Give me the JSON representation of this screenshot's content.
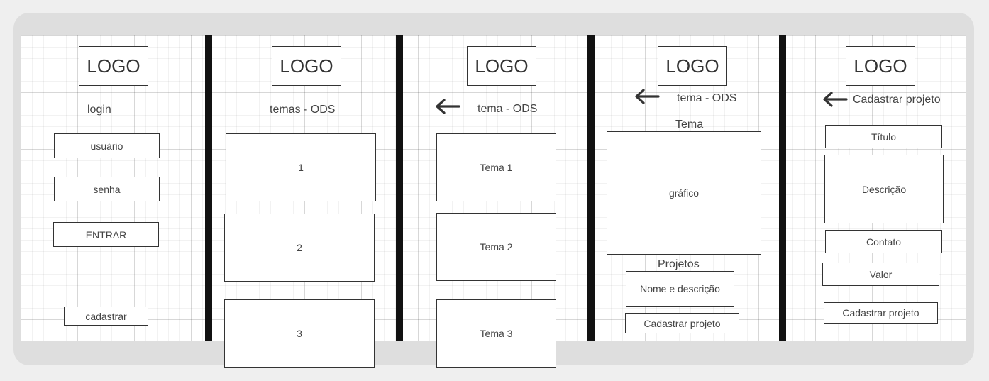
{
  "screens": {
    "login": {
      "logo": "LOGO",
      "title": "login",
      "username_field": "usuário",
      "password_field": "senha",
      "enter_button": "ENTRAR",
      "register_button": "cadastrar"
    },
    "themes": {
      "logo": "LOGO",
      "title": "temas - ODS",
      "items": [
        "1",
        "2",
        "3"
      ]
    },
    "theme_list": {
      "logo": "LOGO",
      "title": "tema - ODS",
      "items": [
        "Tema 1",
        "Tema 2",
        "Tema 3"
      ]
    },
    "theme_detail": {
      "logo": "LOGO",
      "title": "tema - ODS",
      "section_label": "Tema",
      "chart_placeholder": "gráfico",
      "projects_label": "Projetos",
      "project_item": "Nome e descrição",
      "register_project_button": "Cadastrar projeto"
    },
    "register_project": {
      "logo": "LOGO",
      "title": "Cadastrar projeto",
      "title_field": "Título",
      "description_field": "Descrição",
      "contact_field": "Contato",
      "value_field": "Valor",
      "submit_button": "Cadastrar projeto"
    }
  },
  "colors": {
    "frame": "#dedede",
    "canvas": "#ffffff",
    "divider": "#111111",
    "border": "#333333"
  }
}
